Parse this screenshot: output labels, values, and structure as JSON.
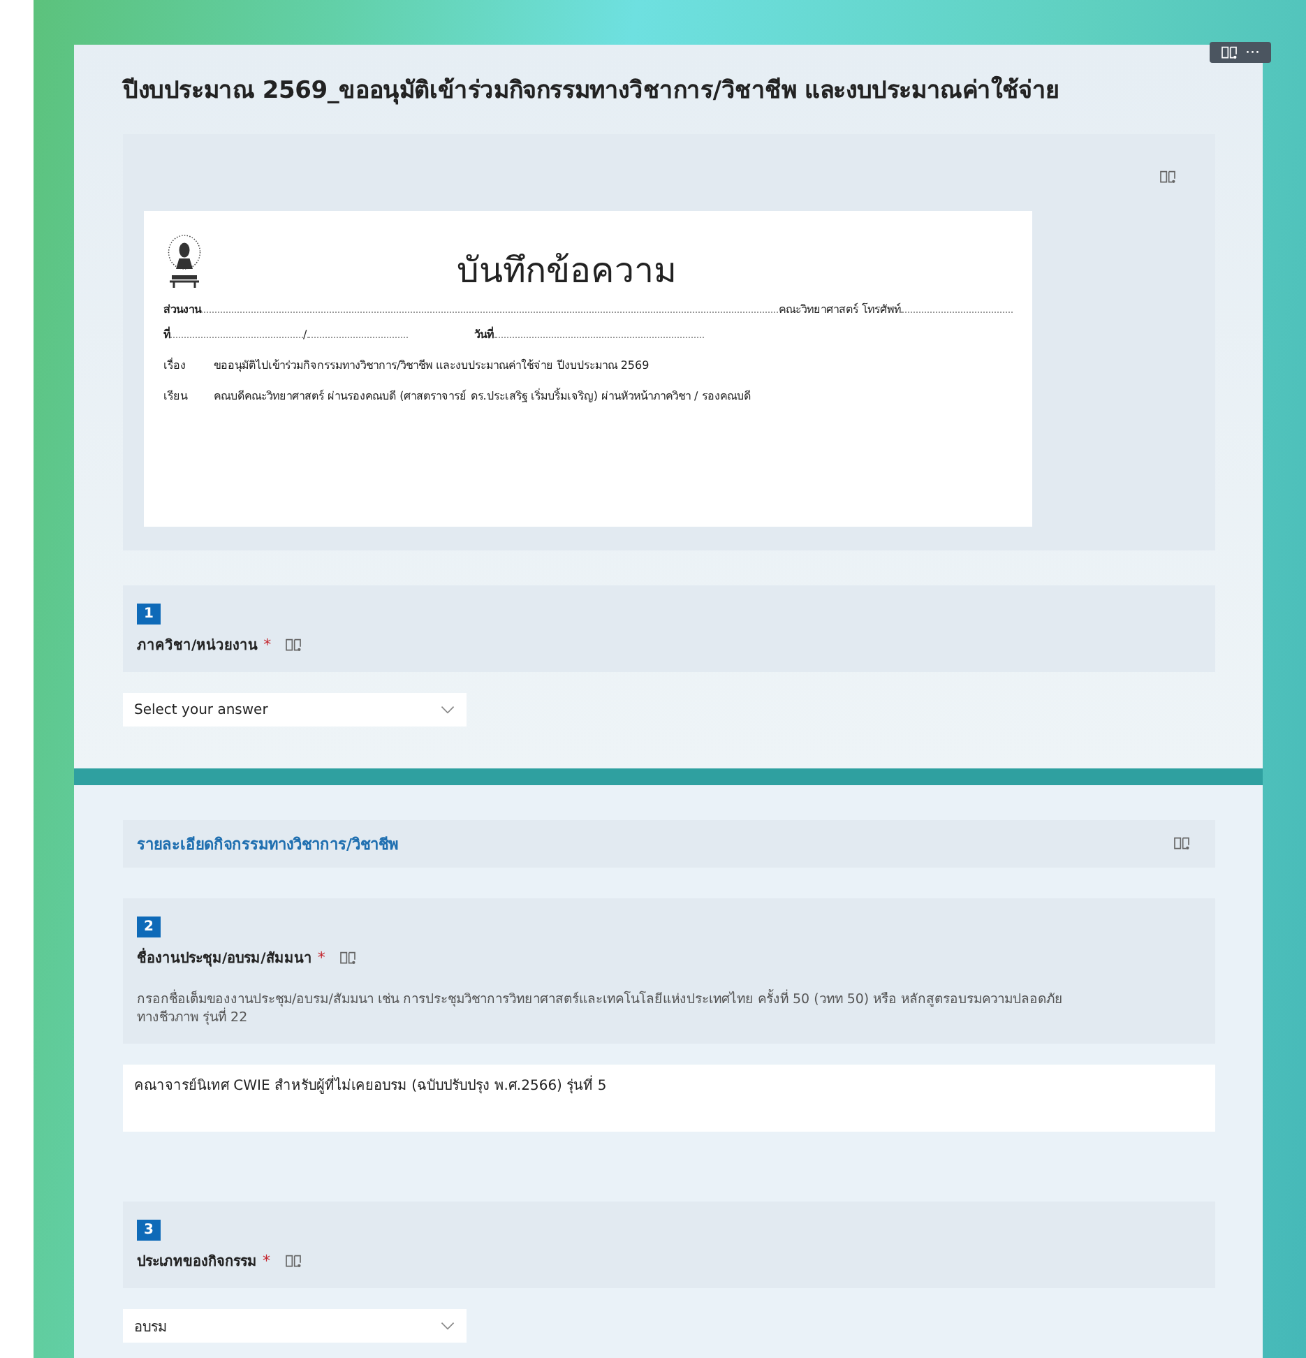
{
  "toolbar": {
    "more": "···"
  },
  "form": {
    "title": "ปีงบประมาณ 2569_ขออนุมัติเข้าร่วมกิจกรรมทางวิชาการ/วิชาชีพ และงบประมาณค่าใช้จ่าย",
    "memo": {
      "heading": "บันทึกข้อความ",
      "lines": [
        {
          "label": "ส่วนงาน",
          "value": "คณะวิทยาศาสตร์ โทรศัพท์",
          "kind": "dotted"
        },
        {
          "label": "ที่",
          "value": "/",
          "date_label": "วันที่",
          "kind": "number"
        },
        {
          "label": "เรื่อง",
          "value": "ขออนุมัติไปเข้าร่วมกิจกรรมทางวิชาการ/วิชาชีพ และงบประมาณค่าใช้จ่าย ปีงบประมาณ 2569",
          "kind": "plain"
        },
        {
          "label": "เรียน",
          "value": "คณบดีคณะวิทยาศาสตร์ ผ่านรองคณบดี (ศาสตราจารย์ ดร.ประเสริฐ เริ่มบริ้มเจริญ) ผ่านหัวหน้าภาควิชา / รองคณบดี",
          "kind": "plain"
        }
      ]
    },
    "sections": [
      {
        "items": [
          {
            "kind": "question",
            "number": "1",
            "label": "ภาควิชา/หน่วยงาน",
            "required_mark": "*",
            "answer": {
              "kind": "dropdown",
              "placeholder": "Select your answer"
            }
          }
        ]
      },
      {
        "items": [
          {
            "kind": "section",
            "title": "รายละเอียดกิจกรรมทางวิชาการ/วิชาชีพ"
          },
          {
            "kind": "question",
            "number": "2",
            "label": "ชื่องานประชุม/อบรม/สัมมนา",
            "required_mark": "*",
            "hint": "กรอกชื่อเต็มของงานประชุม/อบรม/สัมมนา เช่น การประชุมวิชาการวิทยาศาสตร์และเทคโนโลยีแห่งประเทศไทย ครั้งที่ 50 (วทท 50) หรือ หลักสูตรอบรมความปลอดภัยทางชีวภาพ รุ่นที่ 22",
            "answer": {
              "kind": "text",
              "value": "คณาจารย์นิเทศ CWIE สำหรับผู้ที่ไม่เคยอบรม (ฉบับปรับปรุง พ.ศ.2566) รุ่นที่ 5"
            }
          },
          {
            "kind": "question",
            "number": "3",
            "label": "ประเภทของกิจกรรม",
            "required_mark": "*",
            "answer": {
              "kind": "dropdown",
              "value": "อบรม"
            }
          }
        ]
      }
    ]
  }
}
